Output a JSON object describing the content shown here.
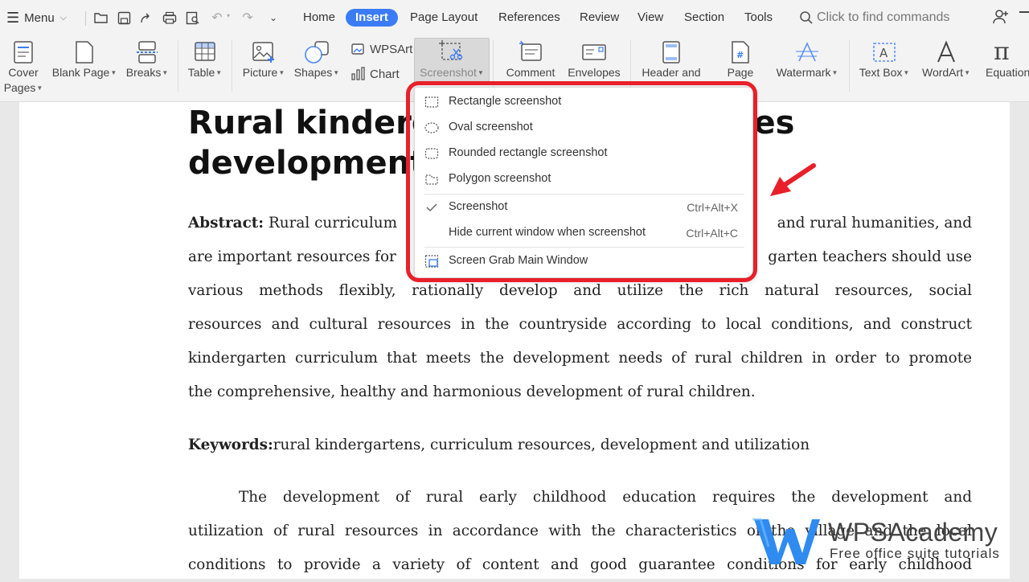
{
  "toolbar": {
    "menu_label": "Menu",
    "tabs": [
      {
        "label": "Home"
      },
      {
        "label": "Insert"
      },
      {
        "label": "Page Layout"
      },
      {
        "label": "References"
      },
      {
        "label": "Review"
      },
      {
        "label": "View"
      },
      {
        "label": "Section"
      },
      {
        "label": "Tools"
      }
    ],
    "active_tab": "Insert",
    "search_placeholder": "Click to find commands"
  },
  "ribbon": {
    "cover_pages_line1": "Cover",
    "cover_pages_line2": "Pages",
    "blank_page": "Blank Page",
    "breaks": "Breaks",
    "table": "Table",
    "picture": "Picture",
    "shapes": "Shapes",
    "wpsart": "WPSArt",
    "chart": "Chart",
    "screenshot": "Screenshot",
    "comment": "Comment",
    "envelopes": "Envelopes",
    "header_footer": "Header and",
    "page_number": "Page",
    "watermark": "Watermark",
    "text_box": "Text Box",
    "wordart": "WordArt",
    "equation": "Equation"
  },
  "screenshot_menu": {
    "items": [
      {
        "label": "Rectangle screenshot",
        "shortcut": ""
      },
      {
        "label": "Oval screenshot",
        "shortcut": ""
      },
      {
        "label": "Rounded rectangle screenshot",
        "shortcut": ""
      },
      {
        "label": "Polygon screenshot",
        "shortcut": ""
      },
      {
        "label": "Screenshot",
        "shortcut": "Ctrl+Alt+X",
        "checked": true
      },
      {
        "label": "Hide current window when screenshot",
        "shortcut": "Ctrl+Alt+C"
      },
      {
        "label": "Screen Grab Main Window",
        "shortcut": ""
      }
    ]
  },
  "document": {
    "title_line1": "Rural kinderga",
    "title_line1_end": "urces",
    "title_line2": "development p",
    "abstract_label": "Abstract:",
    "abstract_l1_start": "Rural curriculum",
    "abstract_l1_end": "and rural humanities, and",
    "abstract_l2_start": "are important resources for",
    "abstract_l2_end": "garten teachers should use",
    "abstract_l3": "various methods flexibly, rationally develop and utilize the rich natural resources, social",
    "abstract_l4": "resources and cultural resources in the countryside according to local conditions, and construct",
    "abstract_l5": "kindergarten curriculum that meets the development needs of rural children in order to promote",
    "abstract_l6": "the comprehensive, healthy and harmonious development of rural children.",
    "keywords_label": "Keywords:",
    "keywords_text": "rural kindergartens, curriculum resources, development and utilization",
    "body_l1": "The development of rural early childhood education requires the development and",
    "body_l2": "utilization of rural resources in accordance with the characteristics of the village and the local",
    "body_l3": "conditions to provide a variety of content and good guarantee conditions for early childhood"
  },
  "watermark_overlay": {
    "brand": "WPSAcademy",
    "tagline": "Free office suite tutorials"
  },
  "colors": {
    "accent": "#3b7cf6",
    "highlight_red": "#e8202a"
  }
}
